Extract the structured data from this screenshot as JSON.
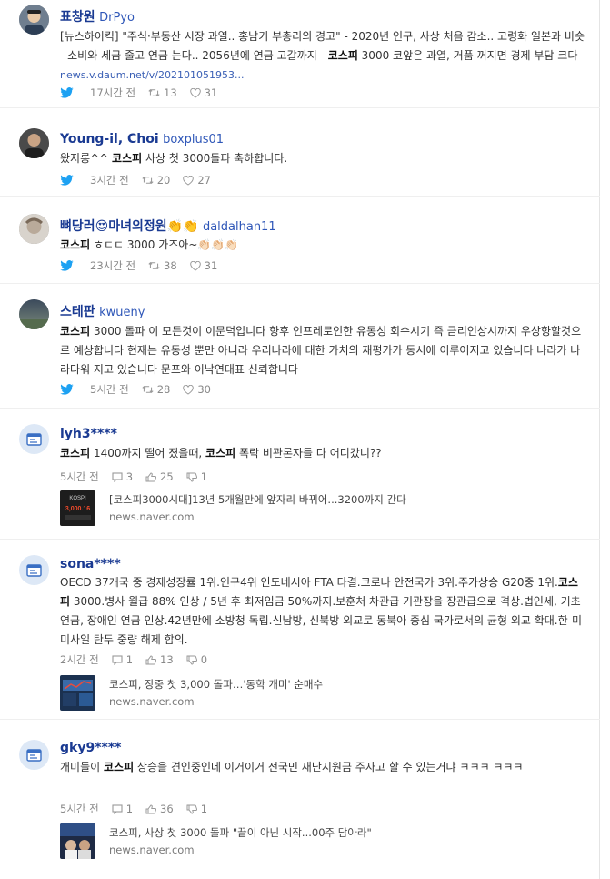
{
  "posts": [
    {
      "type": "twitter",
      "name": "표창원",
      "handle": "DrPyo",
      "text_pre": "[뉴스하이킥] \"주식·부동산 시장 과열.. 홍남기 부총리의 경고\" - 2020년 인구, 사상 처음 감소.. 고령화 일본과 비슷 - 소비와 세금 줄고 연금 는다.. 2056년에 연금 고갈까지 - ",
      "keyword": "코스피",
      "text_post": " 3000 코앞은 과열, 거품 꺼지면 경제 부담 크다 ",
      "link": "news.v.daum.net/v/202101051953...",
      "time": "17시간 전",
      "retweets": "13",
      "likes": "31"
    },
    {
      "type": "twitter",
      "name": "Young-il, Choi",
      "handle": "boxplus01",
      "text_pre": "왔지롱^^ ",
      "keyword": "코스피",
      "text_post": " 사상 첫 3000돌파 축하합니다.",
      "time": "3시간 전",
      "retweets": "20",
      "likes": "27"
    },
    {
      "type": "twitter",
      "name": "뼈당러😍마녀의정원👏👏",
      "handle": "daldalhan11",
      "text_pre": "",
      "keyword": "코스피",
      "text_post": " ㅎㄷㄷ 3000 가즈아~👏🏻👏🏻👏🏻",
      "time": "23시간 전",
      "retweets": "38",
      "likes": "31"
    },
    {
      "type": "twitter",
      "name": "스테판",
      "handle": "kwueny",
      "text_pre": "",
      "keyword": "코스피",
      "text_post": " 3000 돌파 이 모든것이 이문덕입니다 향후 인프레로인한 유동성 회수시기 즉 금리인상시까지 우상향할것으로 예상합니다 현재는 유동성 뿐만 아니라 우리나라에 대한 가치의 재평가가 동시에 이루어지고 있습니다 나라가 나라다워 지고 있습니다 문프와 이낙연대표 신뢰합니다",
      "time": "5시간 전",
      "retweets": "28",
      "likes": "30"
    },
    {
      "type": "comment",
      "name": "lyh3****",
      "text_pre": "",
      "keyword": "코스피",
      "text_mid": " 1400까지 떨어 졌을때, ",
      "keyword2": "코스피",
      "text_post": " 폭락 비관론자들 다 어디갔니??",
      "time": "5시간 전",
      "replies": "3",
      "up": "25",
      "down": "1",
      "news_title": "[코스피3000시대]13년 5개월만에 앞자리 바뀌어...3200까지 간다",
      "news_source": "news.naver.com",
      "thumb_label": "KOSPI",
      "thumb_value": "3,000.16"
    },
    {
      "type": "comment",
      "name": "sona****",
      "text_pre": "OECD 37개국 중 경제성장률 1위.인구4위 인도네시아 FTA 타결.코로나 안전국가 3위.주가상승 G20중 1위.",
      "keyword": "코스피",
      "text_post": " 3000.병사 월급 88% 인상 / 5년 후 최저임금 50%까지.보훈처 차관급 기관장을 장관급으로 격상.법인세, 기초연금, 장애인 연금 인상.42년만에 소방청 독립.신남방, 신북방 외교로 동북아 중심 국가로서의 균형 외교 확대.한-미 미사일 탄두 중량 해제 합의.",
      "time": "2시간 전",
      "replies": "1",
      "up": "13",
      "down": "0",
      "news_title": "코스피, 장중 첫 3,000 돌파…'동학 개미' 순매수",
      "news_source": "news.naver.com"
    },
    {
      "type": "comment",
      "name": "gky9****",
      "text_pre": "개미들이 ",
      "keyword": "코스피",
      "text_post": " 상승을 견인중인데 이거이거 전국민 재난지원금 주자고 할 수 있는거냐 ㅋㅋㅋ ㅋㅋㅋ",
      "time": "5시간 전",
      "replies": "1",
      "up": "36",
      "down": "1",
      "news_title": "코스피, 사상 첫 3000 돌파 \"끝이 아닌 시작...00주 담아라\"",
      "news_source": "news.naver.com"
    }
  ]
}
